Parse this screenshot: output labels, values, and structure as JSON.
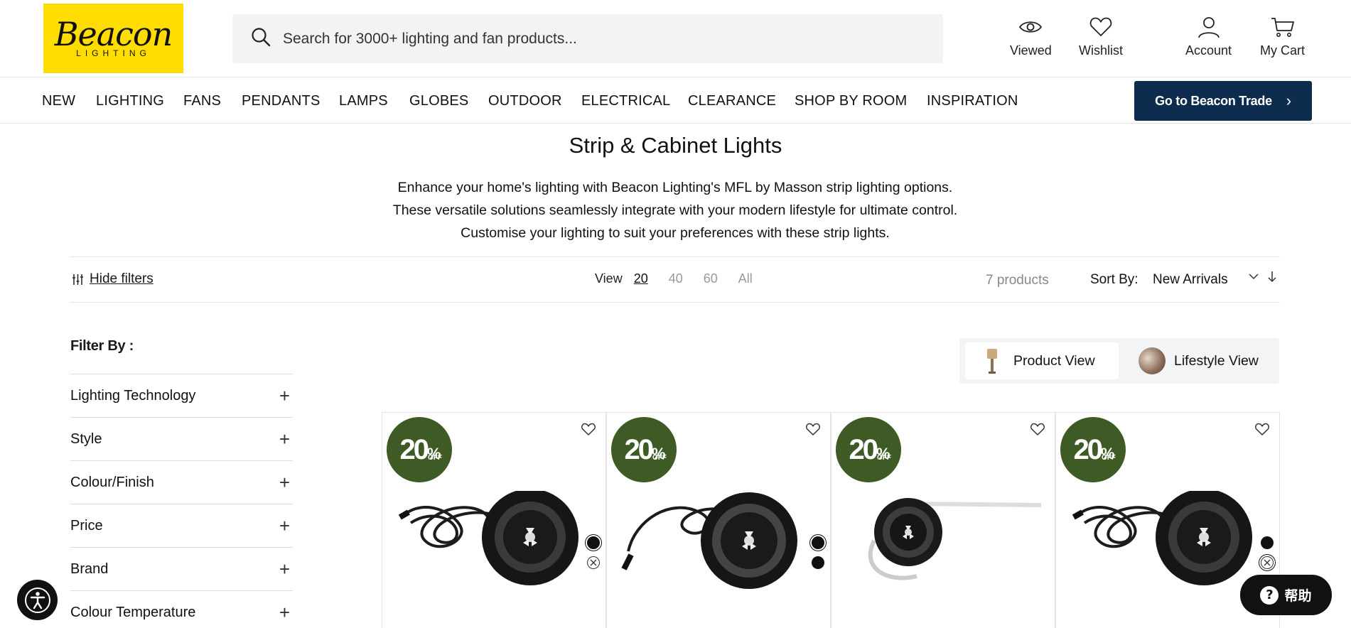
{
  "header": {
    "logo_text": "Beacon",
    "logo_subtext": "LIGHTING",
    "search_placeholder": "Search for 3000+ lighting and fan products...",
    "icons": [
      {
        "label": "Viewed",
        "icon": "eye-icon"
      },
      {
        "label": "Wishlist",
        "icon": "heart-icon"
      },
      {
        "label": "Account",
        "icon": "user-icon"
      },
      {
        "label": "My Cart",
        "icon": "cart-icon"
      }
    ]
  },
  "nav": {
    "items": [
      "NEW",
      "LIGHTING",
      "FANS",
      "PENDANTS",
      "LAMPS",
      "GLOBES",
      "OUTDOOR",
      "ELECTRICAL",
      "CLEARANCE",
      "SHOP BY ROOM",
      "INSPIRATION"
    ],
    "trade_button": "Go to Beacon Trade"
  },
  "page": {
    "title": "Strip & Cabinet Lights",
    "intro": "Enhance your home's lighting with Beacon Lighting's MFL by Masson strip lighting options. These versatile solutions seamlessly integrate with your modern lifestyle for ultimate control. Customise your lighting to suit your preferences with these strip lights."
  },
  "toolbar": {
    "hide_filters": "Hide filters",
    "view_label": "View",
    "view_options": [
      "20",
      "40",
      "60",
      "All"
    ],
    "view_selected": "20",
    "product_count": "7 products",
    "sort_label": "Sort By:",
    "sort_value": "New Arrivals"
  },
  "filters": {
    "title": "Filter By :",
    "items": [
      "Lighting Technology",
      "Style",
      "Colour/Finish",
      "Price",
      "Brand",
      "Colour Temperature"
    ]
  },
  "view_toggle": {
    "product_view": "Product View",
    "lifestyle_view": "Lifestyle View",
    "selected": "Product View"
  },
  "products": [
    {
      "badge_value": "20",
      "badge_unit": "%",
      "badge_text": "OFF",
      "swatches": [
        "#111111",
        "none"
      ]
    },
    {
      "badge_value": "20",
      "badge_unit": "%",
      "badge_text": "OFF",
      "swatches": [
        "#111111",
        "#111111"
      ]
    },
    {
      "badge_value": "20",
      "badge_unit": "%",
      "badge_text": "OFF",
      "swatches": []
    },
    {
      "badge_value": "20",
      "badge_unit": "%",
      "badge_text": "OFF",
      "swatches": [
        "#111111",
        "none"
      ]
    }
  ],
  "colors": {
    "trade_button_bg": "#0d2c4e",
    "badge_green": "#3e5b26",
    "logo_yellow": "#ffdd00"
  },
  "help_button": "帮助"
}
